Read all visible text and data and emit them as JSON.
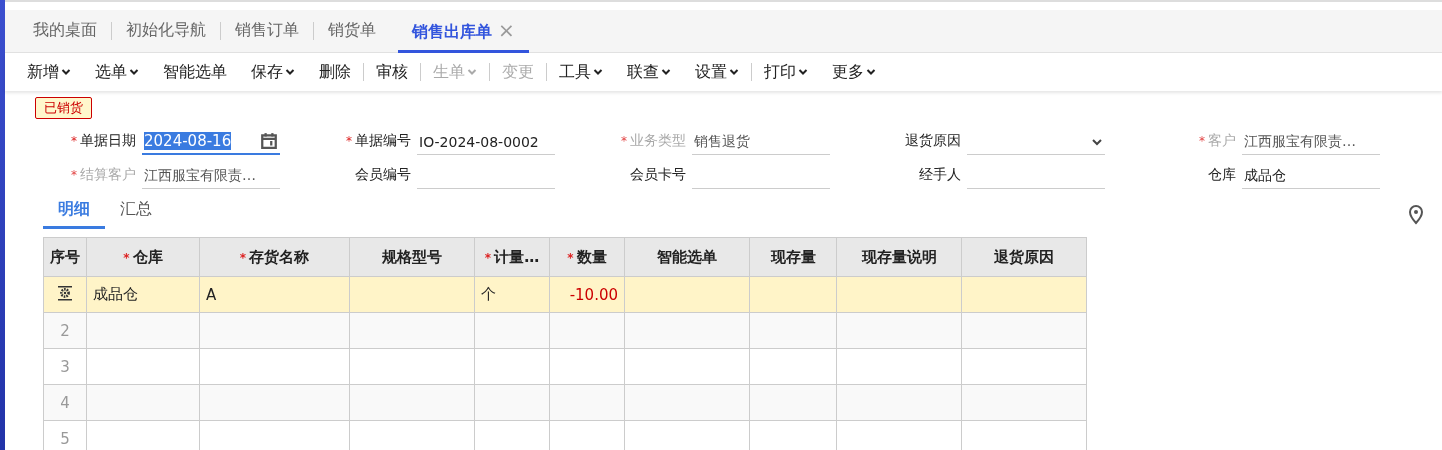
{
  "tabs": [
    {
      "label": "我的桌面",
      "selected": false,
      "closable": false
    },
    {
      "label": "初始化导航",
      "selected": false,
      "closable": false
    },
    {
      "label": "销售订单",
      "selected": false,
      "closable": false
    },
    {
      "label": "销货单",
      "selected": false,
      "closable": false
    },
    {
      "label": "销售出库单",
      "selected": true,
      "closable": true,
      "close_glyph": "×"
    }
  ],
  "toolbar": [
    {
      "label": "新增",
      "dropdown": true,
      "disabled": false,
      "divider_after": false
    },
    {
      "label": "选单",
      "dropdown": true,
      "disabled": false,
      "divider_after": false
    },
    {
      "label": "智能选单",
      "dropdown": false,
      "disabled": false,
      "divider_after": false
    },
    {
      "label": "保存",
      "dropdown": true,
      "disabled": false,
      "divider_after": false
    },
    {
      "label": "删除",
      "dropdown": false,
      "disabled": false,
      "divider_after": true
    },
    {
      "label": "审核",
      "dropdown": false,
      "disabled": false,
      "divider_after": true
    },
    {
      "label": "生单",
      "dropdown": true,
      "disabled": true,
      "divider_after": true
    },
    {
      "label": "变更",
      "dropdown": false,
      "disabled": true,
      "divider_after": true
    },
    {
      "label": "工具",
      "dropdown": true,
      "disabled": false,
      "divider_after": false
    },
    {
      "label": "联查",
      "dropdown": true,
      "disabled": false,
      "divider_after": false
    },
    {
      "label": "设置",
      "dropdown": true,
      "disabled": false,
      "divider_after": true
    },
    {
      "label": "打印",
      "dropdown": true,
      "disabled": false,
      "divider_after": false
    },
    {
      "label": "更多",
      "dropdown": true,
      "disabled": false,
      "divider_after": false
    }
  ],
  "status_badge": "已销货",
  "fields": [
    {
      "label": "单据日期",
      "kind": "date",
      "required_mark": "*",
      "disabled": false,
      "value": "2024-08-16",
      "focused": true
    },
    {
      "label": "单据编号",
      "kind": "text",
      "required_mark": "*",
      "disabled": false,
      "value": "IO-2024-08-0002",
      "focused": false
    },
    {
      "label": "业务类型",
      "kind": "text",
      "required_mark": "*",
      "disabled": true,
      "value": "销售退货",
      "focused": false
    },
    {
      "label": "退货原因",
      "kind": "select",
      "disabled": false,
      "focused": false
    },
    {
      "label": "客户",
      "kind": "text",
      "required_mark": "*",
      "disabled": true,
      "value": "江西服宝有限责…",
      "focused": false
    },
    {
      "label": "结算客户",
      "kind": "text",
      "required_mark": "*",
      "disabled": true,
      "value": "江西服宝有限责…",
      "focused": false
    },
    {
      "label": "会员编号",
      "kind": "text",
      "disabled": false,
      "focused": false
    },
    {
      "label": "会员卡号",
      "kind": "text",
      "disabled": false,
      "focused": false
    },
    {
      "label": "经手人",
      "kind": "text",
      "disabled": false,
      "focused": false
    },
    {
      "label": "仓库",
      "kind": "text",
      "disabled": false,
      "value": "成品仓",
      "focused": false
    }
  ],
  "sub_tabs": [
    {
      "label": "明细",
      "selected": true
    },
    {
      "label": "汇总",
      "selected": false
    }
  ],
  "table": {
    "columns": [
      {
        "label": "序号",
        "kind": "index"
      },
      {
        "label": "仓库",
        "required_mark": "*",
        "kind": "text"
      },
      {
        "label": "存货名称",
        "required_mark": "*",
        "kind": "text"
      },
      {
        "label": "规格型号",
        "kind": "text"
      },
      {
        "label": "计量…",
        "required_mark": "*",
        "kind": "text"
      },
      {
        "label": "数量",
        "required_mark": "*",
        "kind": "number"
      },
      {
        "label": "智能选单",
        "kind": "text"
      },
      {
        "label": "现存量",
        "kind": "text"
      },
      {
        "label": "现存量说明",
        "kind": "text"
      },
      {
        "label": "退货原因",
        "kind": "text"
      }
    ],
    "rows": [
      {
        "selected": true,
        "cells": [
          "",
          "成品仓",
          "A",
          "",
          "个",
          "-10.00",
          "",
          "",
          "",
          ""
        ]
      },
      {
        "selected": false,
        "cells": [
          "2",
          "",
          "",
          "",
          "",
          "",
          "",
          "",
          "",
          ""
        ]
      },
      {
        "selected": false,
        "cells": [
          "3",
          "",
          "",
          "",
          "",
          "",
          "",
          "",
          "",
          ""
        ]
      },
      {
        "selected": false,
        "cells": [
          "4",
          "",
          "",
          "",
          "",
          "",
          "",
          "",
          "",
          ""
        ]
      },
      {
        "selected": false,
        "cells": [
          "5",
          "",
          "",
          "",
          "",
          "",
          "",
          "",
          "",
          ""
        ]
      }
    ]
  }
}
